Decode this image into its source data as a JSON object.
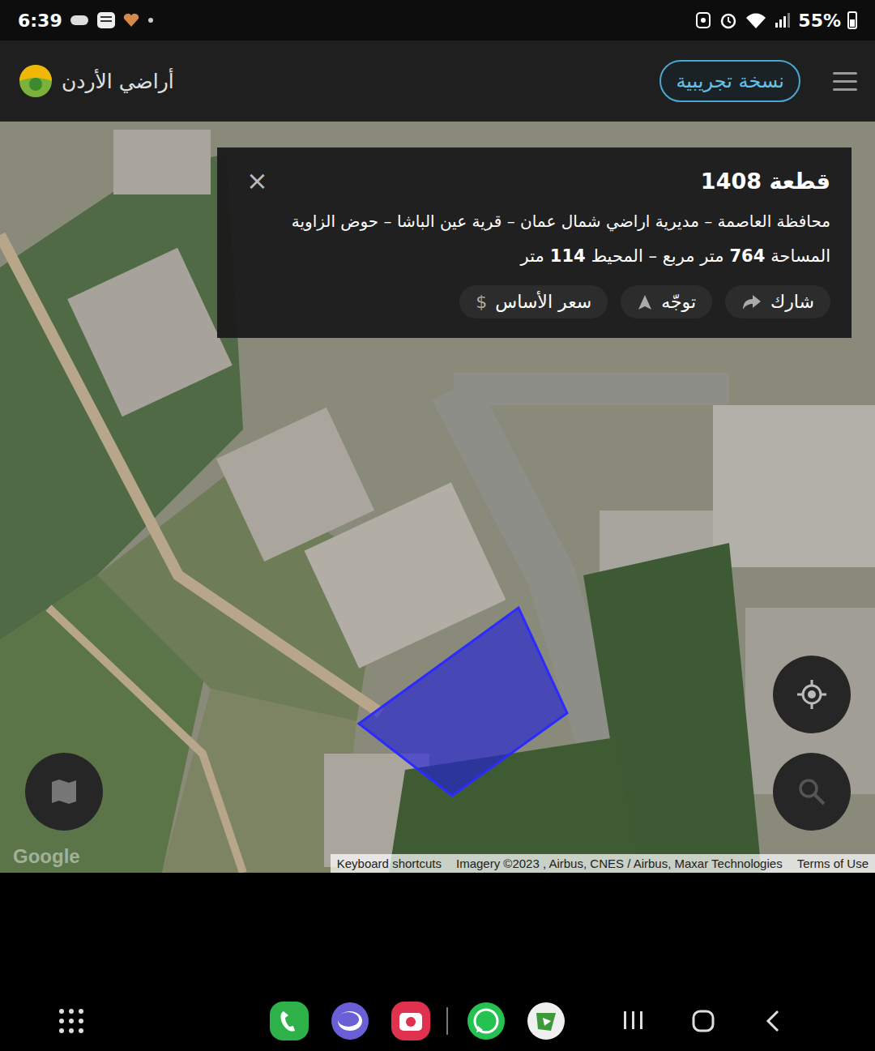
{
  "status_bar": {
    "time": "6:39",
    "battery": "55%",
    "battery_level": 0.55
  },
  "header": {
    "app_title": "أراضي الأردن",
    "beta_button": "نسخة تجريبية"
  },
  "parcel_card": {
    "title": "قطعة 1408",
    "close": "×",
    "location": "محافظة العاصمة – مديرية اراضي شمال عمان – قرية عين الباشا – حوض الزاوية",
    "area_parts": [
      {
        "text": "المساحة",
        "bold": false
      },
      {
        "text": "764",
        "bold": true
      },
      {
        "text": "متر مربع – المحيط",
        "bold": false
      },
      {
        "text": "114",
        "bold": true
      },
      {
        "text": "متر",
        "bold": false
      }
    ],
    "actions": [
      {
        "label": "شارك",
        "kind": "share"
      },
      {
        "label": "توجّه",
        "kind": "navigate"
      },
      {
        "label": "سعر الأساس",
        "kind": "price",
        "icon": "$"
      }
    ]
  },
  "map": {
    "watermark": "Google",
    "attribution": [
      {
        "label": "Keyboard shortcuts"
      },
      {
        "label": "Imagery ©2023 , Airbus, CNES / Airbus, Maxar Technologies"
      },
      {
        "label": "Terms of Use"
      }
    ]
  }
}
